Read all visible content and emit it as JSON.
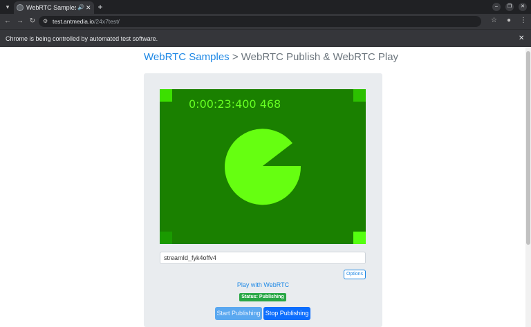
{
  "browser": {
    "tab_title": "WebRTC Samples > P",
    "tab_close_glyph": "✕",
    "new_tab_glyph": "+",
    "url_host": "test.antmedia.io",
    "url_path": "/24x7test/",
    "infobar_text": "Chrome is being controlled by automated test software.",
    "icons": {
      "tab_menu": "chevron-down-icon",
      "audio": "speaker-icon",
      "back": "arrow-left-icon",
      "forward": "arrow-right-icon",
      "reload": "reload-icon",
      "site_info": "tune-icon",
      "bookmark": "star-icon",
      "profile": "person-icon",
      "menu": "kebab-icon"
    }
  },
  "page": {
    "heading_link": "WebRTC Samples",
    "heading_rest": " > WebRTC Publish & WebRTC Play",
    "video": {
      "timer": "0:00:23:400 468",
      "colors": {
        "background": "#1a8000",
        "shape": "#66ff11"
      }
    },
    "stream_id_value": "streamId_fyk4offv4",
    "options_label": "Options",
    "play_link": "Play with WebRTC",
    "status": "Status: Publishing",
    "start_label": "Start Publishing",
    "stop_label": "Stop Publishing",
    "colors": {
      "accent": "#1e88e5",
      "status": "#28a745"
    }
  }
}
